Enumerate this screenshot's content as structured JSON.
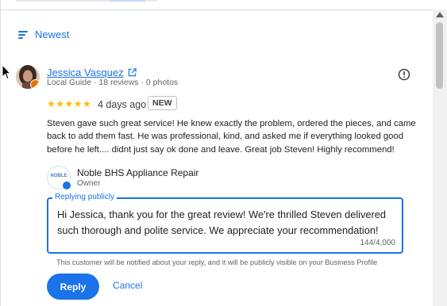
{
  "sort": {
    "label": "Newest",
    "icon": "sort-icon"
  },
  "review": {
    "author_name": "Jessica Vasquez",
    "author_meta": "Local Guide · 18 reviews · 0 photos",
    "rating": 5,
    "stars_text": "★★★★★",
    "date": "4 days ago",
    "badge": "NEW",
    "text": "Steven gave such great service! He knew exactly the problem, ordered the pieces, and came back to add them fast. He was professional, kind, and asked me if everything looked good before he left.... didnt just say ok done and leave. Great job Steven! Highly recommend!"
  },
  "owner": {
    "business_name": "Noble BHS Appliance Repair",
    "role": "Owner",
    "logo_text": "NOBLE"
  },
  "reply": {
    "label": "Replying publicly",
    "text": "Hi Jessica, thank you for the great review! We're thrilled Steven delivered such thorough and polite service. We appreciate your recommendation!",
    "char_count": "144/4,000",
    "notice": "This customer will be notified about your reply, and it will be publicly visible on your Business Profile",
    "reply_button": "Reply",
    "cancel_button": "Cancel"
  },
  "colors": {
    "accent": "#1a73e8",
    "star": "#fbbc04",
    "text": "#202124",
    "muted": "#5f6368"
  }
}
